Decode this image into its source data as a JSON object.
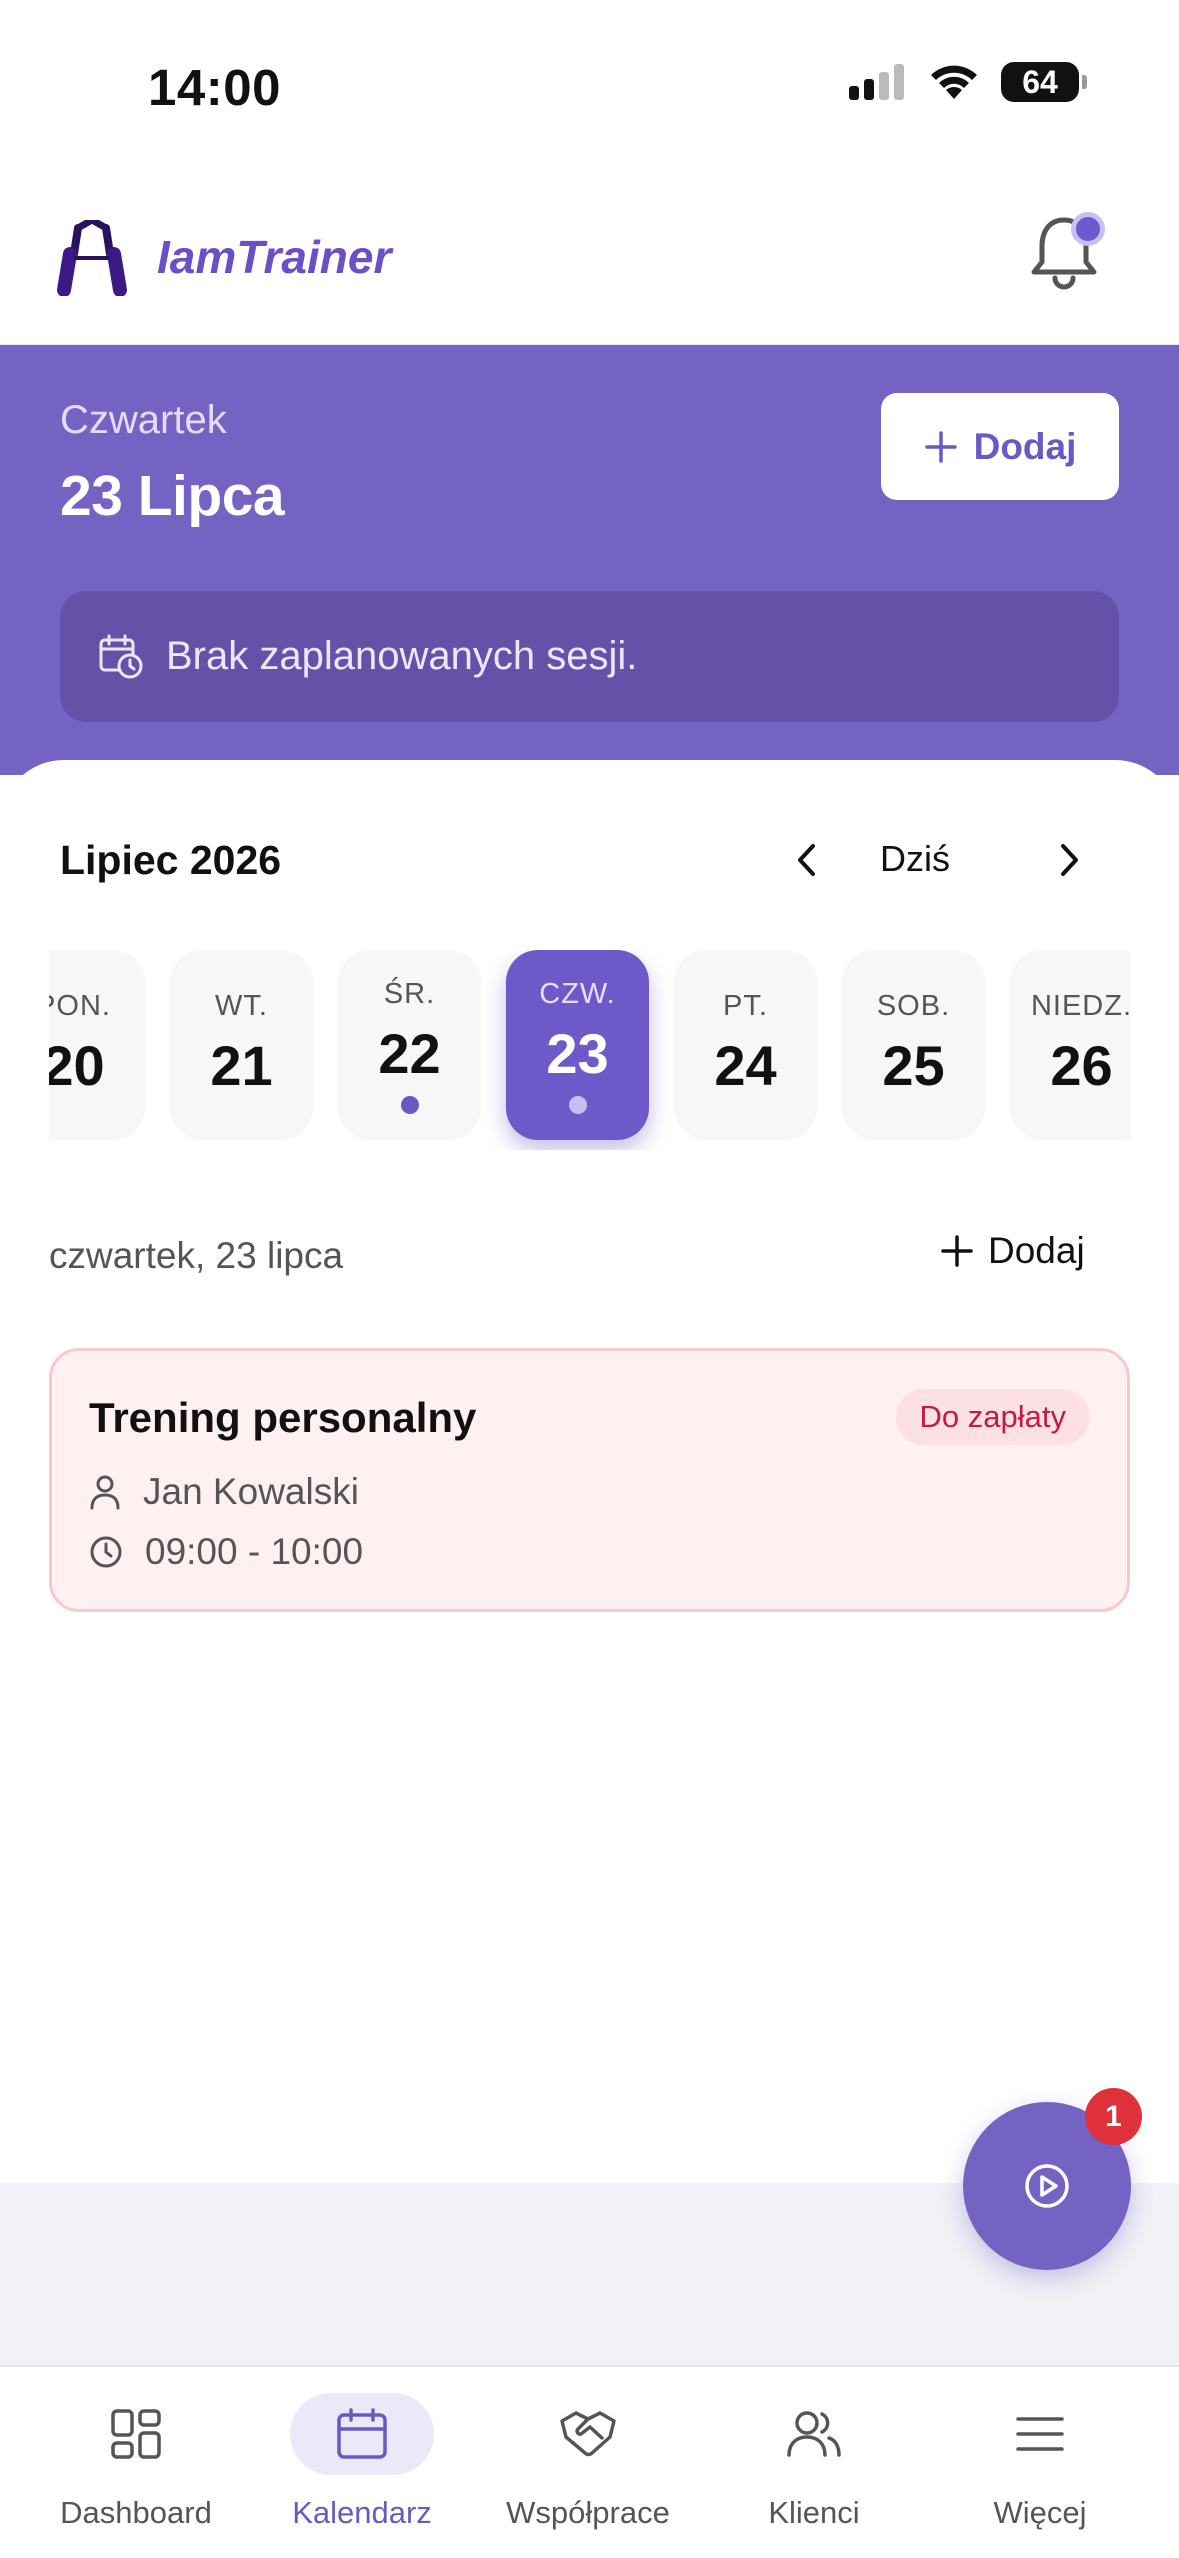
{
  "status_bar": {
    "time": "14:00",
    "battery": "64"
  },
  "header": {
    "app_name": "IamTrainer"
  },
  "hero": {
    "weekday": "Czwartek",
    "date": "23 Lipca",
    "add_label": "Dodaj",
    "info": "Brak zaplanowanych sesji."
  },
  "calendar": {
    "month": "Lipiec 2026",
    "today_label": "Dziś",
    "days": [
      {
        "dow": "PON.",
        "num": "20"
      },
      {
        "dow": "WT.",
        "num": "21"
      },
      {
        "dow": "ŚR.",
        "num": "22"
      },
      {
        "dow": "CZW.",
        "num": "23"
      },
      {
        "dow": "PT.",
        "num": "24"
      },
      {
        "dow": "SOB.",
        "num": "25"
      },
      {
        "dow": "NIEDZ.",
        "num": "26"
      }
    ],
    "selected_date": "czwartek, 23 lipca",
    "add_label": "Dodaj"
  },
  "session": {
    "title": "Trening personalny",
    "status": "Do zapłaty",
    "client": "Jan Kowalski",
    "time": "09:00 - 10:00"
  },
  "fab": {
    "badge": "1"
  },
  "tabbar": {
    "items": [
      {
        "label": "Dashboard",
        "icon": "grid-icon"
      },
      {
        "label": "Kalendarz",
        "icon": "calendar-icon"
      },
      {
        "label": "Współprace",
        "icon": "handshake-icon"
      },
      {
        "label": "Klienci",
        "icon": "users-icon"
      },
      {
        "label": "Więcej",
        "icon": "menu-icon"
      }
    ]
  },
  "colors": {
    "primary": "#7563c4",
    "badge_red": "#e0303c",
    "session_bg": "#fff0f1"
  }
}
